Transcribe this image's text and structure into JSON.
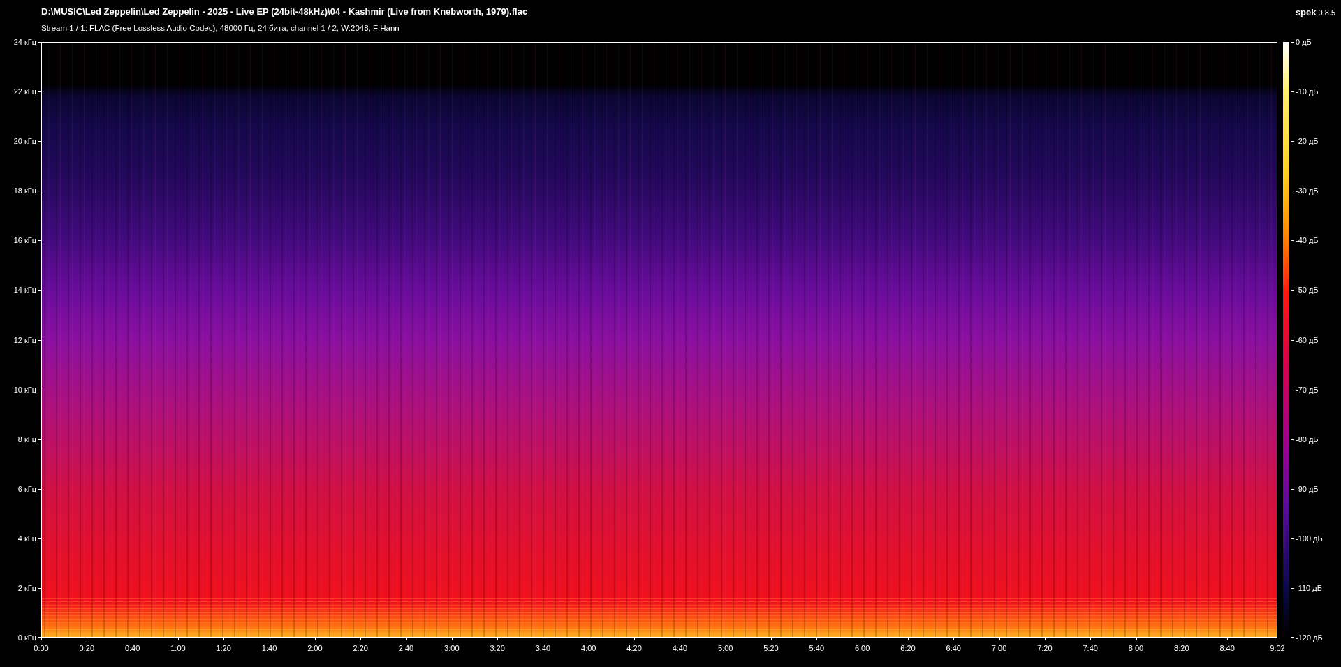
{
  "title": "D:\\MUSIC\\Led Zeppelin\\Led Zeppelin - 2025 - Live EP (24bit-48kHz)\\04 - Kashmir (Live from Knebworth, 1979).flac",
  "stream_info": "Stream 1 / 1: FLAC (Free Lossless Audio Codec), 48000 Гц, 24 бита, channel 1 / 2, W:2048, F:Hann",
  "app": {
    "name": "spek",
    "version": "0.8.5"
  },
  "frequency_axis": [
    "24 кГц",
    "22 кГц",
    "20 кГц",
    "18 кГц",
    "16 кГц",
    "14 кГц",
    "12 кГц",
    "10 кГц",
    "8 кГц",
    "6 кГц",
    "4 кГц",
    "2 кГц",
    "0 кГц"
  ],
  "time_axis": [
    "0:00",
    "0:20",
    "0:40",
    "1:00",
    "1:20",
    "1:40",
    "2:00",
    "2:20",
    "2:40",
    "3:00",
    "3:20",
    "3:40",
    "4:00",
    "4:20",
    "4:40",
    "5:00",
    "5:20",
    "5:40",
    "6:00",
    "6:20",
    "6:40",
    "7:00",
    "7:20",
    "7:40",
    "8:00",
    "8:20",
    "8:40",
    "9:02"
  ],
  "db_scale": [
    "0 дБ",
    "-10 дБ",
    "-20 дБ",
    "-30 дБ",
    "-40 дБ",
    "-50 дБ",
    "-60 дБ",
    "-70 дБ",
    "-80 дБ",
    "-90 дБ",
    "-100 дБ",
    "-110 дБ",
    "-120 дБ"
  ]
}
